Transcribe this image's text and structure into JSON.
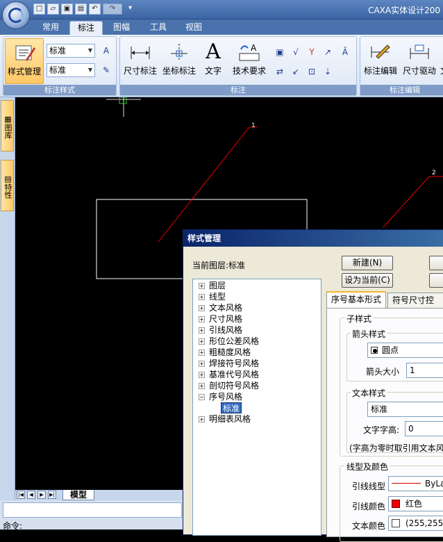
{
  "app": {
    "title": "CAXA实体设计200"
  },
  "quick_access": {
    "icons": [
      "new-file-icon",
      "open-folder-icon",
      "save-icon",
      "print-icon",
      "undo-icon",
      "redo-icon",
      "customize-icon"
    ]
  },
  "tabs": [
    {
      "label": "常用"
    },
    {
      "label": "标注"
    },
    {
      "label": "图幅"
    },
    {
      "label": "工具"
    },
    {
      "label": "视图"
    }
  ],
  "ribbon": {
    "style_group": {
      "caption": "标注样式",
      "style_manage_label": "样式管理",
      "combo1": "标准",
      "combo2": "标准"
    },
    "annotate_group": {
      "caption": "标注",
      "dimension_label": "尺寸标注",
      "coordinate_label": "坐标标注",
      "text_label": "文字",
      "text_glyph": "A",
      "tech_req_label": "技术要求"
    },
    "edit_group": {
      "caption": "标注编辑",
      "annot_edit_label": "标注编辑",
      "dim_drive_label": "尺寸驱动",
      "cut_label": "文"
    }
  },
  "sidebar": {
    "tab1": "图库",
    "tab2": "特性"
  },
  "canvas": {
    "balloon1": "1",
    "balloon2": "2"
  },
  "bottom": {
    "model_tab": "模型",
    "command_label": "命令:"
  },
  "dialog": {
    "title": "样式管理",
    "current_layer": "当前图层:标准",
    "new_button": "新建(N)",
    "set_current_button": "设为当前(C)",
    "tree": [
      "图层",
      "线型",
      "文本风格",
      "尺寸风格",
      "引线风格",
      "形位公差风格",
      "粗糙度风格",
      "焊接符号风格",
      "基准代号风格",
      "剖切符号风格",
      "序号风格",
      "标准",
      "明细表风格"
    ],
    "tab_basic": "序号基本形式",
    "tab_size": "符号尺寸控制",
    "sub_style": "子样式",
    "arrow_style_label": "箭头样式",
    "arrow_style_value": "圆点",
    "arrow_size_label": "箭头大小",
    "arrow_size_value": "1",
    "text_style_label": "文本样式",
    "text_style_value": "标准",
    "text_height_label": "文字字高:",
    "text_height_value": "0",
    "note": "(字高为零时取引用文本风",
    "line_color_group": "线型及颜色",
    "leader_linetype_label": "引线线型",
    "leader_linetype_value": "ByLay",
    "leader_color_label": "引线颜色",
    "leader_color_value": "红色",
    "text_color_label": "文本颜色",
    "text_color_value": "(255,255,"
  }
}
